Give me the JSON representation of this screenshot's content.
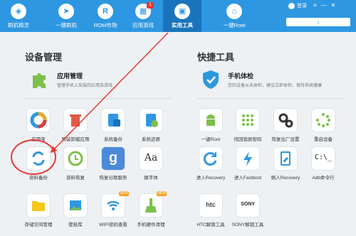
{
  "nav": [
    {
      "label": "刷机精灵",
      "icon": "shield-logo-icon"
    },
    {
      "label": "一键刷机",
      "icon": "cursor-icon"
    },
    {
      "label": "ROM市场",
      "icon": "rom-icon"
    },
    {
      "label": "应用游戏",
      "icon": "apps-icon",
      "badge": "1"
    },
    {
      "label": "实用工具",
      "icon": "tools-icon",
      "active": true
    },
    {
      "label": "一键Root",
      "icon": "root-icon"
    }
  ],
  "login_label": "登录",
  "window_controls": [
    "≡",
    "—",
    "✕"
  ],
  "progress_icon": "↓",
  "device_section_title": "设备管理",
  "quick_section_title": "快捷工具",
  "app_manager": {
    "title": "应用管理",
    "desc": "管理手机上安装的应用及游戏"
  },
  "phone_check": {
    "title": "手机体检",
    "desc": "您的设备从未体检，建议立即体检，保持系统健康"
  },
  "device_tools": [
    {
      "label": "应用宝",
      "icon": "yingyongbao-icon"
    },
    {
      "label": "预装卸载应用",
      "icon": "trash-icon"
    },
    {
      "label": "系统备份",
      "icon": "system-backup-icon"
    },
    {
      "label": "系统还原",
      "icon": "system-restore-icon"
    },
    {
      "label": "资料备份",
      "icon": "data-backup-icon"
    },
    {
      "label": "资料恢复",
      "icon": "data-restore-icon"
    },
    {
      "label": "恢复谷歌服务",
      "icon": "google-icon"
    },
    {
      "label": "换字体",
      "icon": "font-icon"
    },
    {
      "label": "存储空间管理",
      "icon": "folder-icon",
      "new": true
    },
    {
      "label": "壁纸库",
      "icon": "wallpaper-icon"
    },
    {
      "label": "WIFI密码查看",
      "icon": "wifi-icon",
      "new": true
    },
    {
      "label": "手机硬件清理",
      "icon": "broom-icon",
      "new": true
    }
  ],
  "quick_tools": [
    {
      "label": "一键Root",
      "icon": "android-icon"
    },
    {
      "label": "找回锁屏密码",
      "icon": "pattern-lock-icon"
    },
    {
      "label": "恢复出厂设置",
      "icon": "gears-icon"
    },
    {
      "label": "重启设备",
      "icon": "loading-icon"
    },
    {
      "label": "进入Recovery",
      "icon": "refresh-icon"
    },
    {
      "label": "进入Fastboot",
      "icon": "lightning-icon"
    },
    {
      "label": "刷入Recovery",
      "icon": "tablet-edit-icon"
    },
    {
      "label": "Adb命令行",
      "icon": "terminal-icon"
    },
    {
      "label": "HTC解锁工具",
      "icon": "htc-icon"
    },
    {
      "label": "SONY解锁工具",
      "icon": "sony-icon"
    }
  ],
  "tool_texts": {
    "google": "g",
    "font": "Aa",
    "terminal": "C:\\_",
    "htc": "htc",
    "sony": "SONY"
  },
  "colors": {
    "topbar": "#2e97e1",
    "active_tab": "#1a74bd",
    "highlight": "#e53935",
    "accent_blue": "#2e97e1",
    "green": "#7cc04b"
  }
}
